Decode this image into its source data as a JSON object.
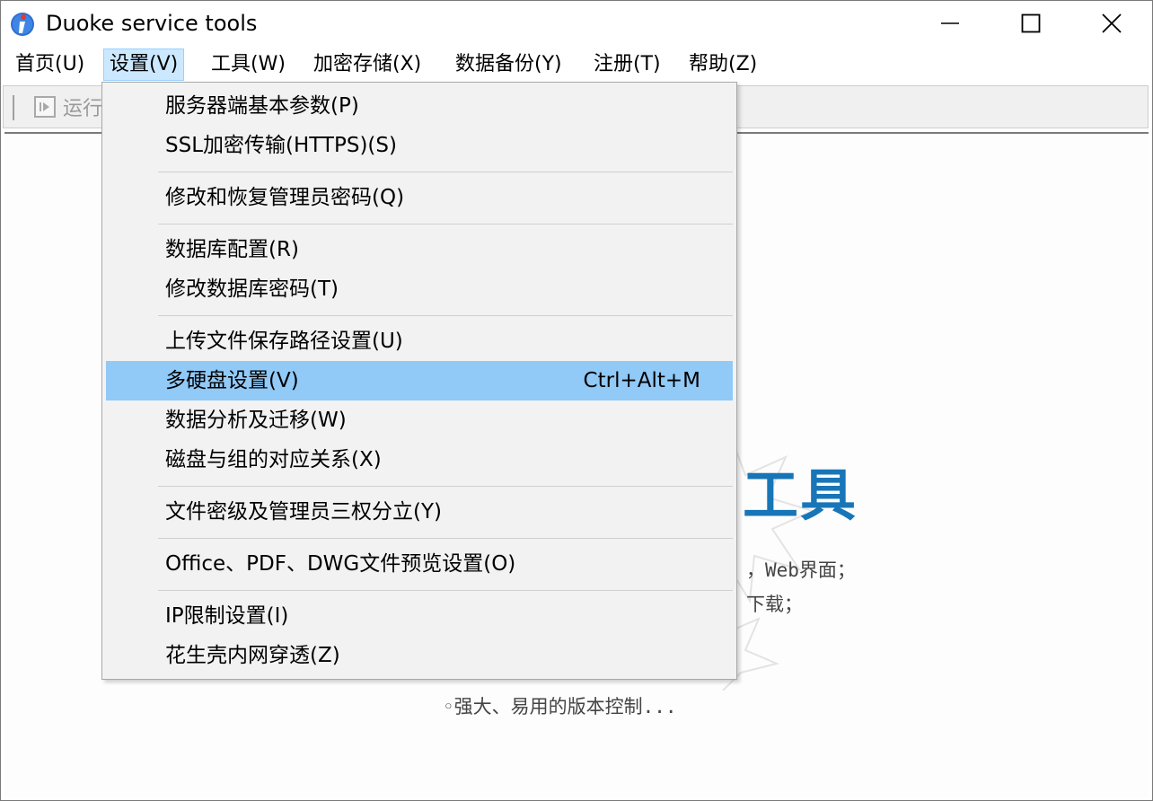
{
  "window": {
    "title": "Duoke service tools"
  },
  "menubar": {
    "items": [
      {
        "label": "首页(U)"
      },
      {
        "label": "设置(V)"
      },
      {
        "label": "工具(W)"
      },
      {
        "label": "加密存储(X)"
      },
      {
        "label": "数据备份(Y)"
      },
      {
        "label": "注册(T)"
      },
      {
        "label": "帮助(Z)"
      }
    ],
    "active_index": 1
  },
  "toolbar": {
    "run_label": "运行"
  },
  "settings_menu": {
    "items": [
      {
        "label": "服务器端基本参数(P)",
        "shortcut": ""
      },
      {
        "label": "SSL加密传输(HTTPS)(S)",
        "shortcut": ""
      },
      {
        "label": "修改和恢复管理员密码(Q)",
        "shortcut": ""
      },
      {
        "label": "数据库配置(R)",
        "shortcut": ""
      },
      {
        "label": "修改数据库密码(T)",
        "shortcut": ""
      },
      {
        "label": "上传文件保存路径设置(U)",
        "shortcut": ""
      },
      {
        "label": "多硬盘设置(V)",
        "shortcut": "Ctrl+Alt+M"
      },
      {
        "label": "数据分析及迁移(W)",
        "shortcut": ""
      },
      {
        "label": "磁盘与组的对应关系(X)",
        "shortcut": ""
      },
      {
        "label": "文件密级及管理员三权分立(Y)",
        "shortcut": ""
      },
      {
        "label": "Office、PDF、DWG文件预览设置(O)",
        "shortcut": ""
      },
      {
        "label": "IP限制设置(I)",
        "shortcut": ""
      },
      {
        "label": "花生壳内网穿透(Z)",
        "shortcut": ""
      }
    ],
    "highlighted_index": 6
  },
  "content": {
    "title_fragment": "工具",
    "feature_1": "，Web界面；",
    "feature_2": "下载；",
    "feature_3": "◦强大、易用的版本控制..."
  },
  "colors": {
    "highlight": "#91c9f7",
    "menubar_active": "#cce8ff",
    "title_blue": "#1876b8"
  }
}
